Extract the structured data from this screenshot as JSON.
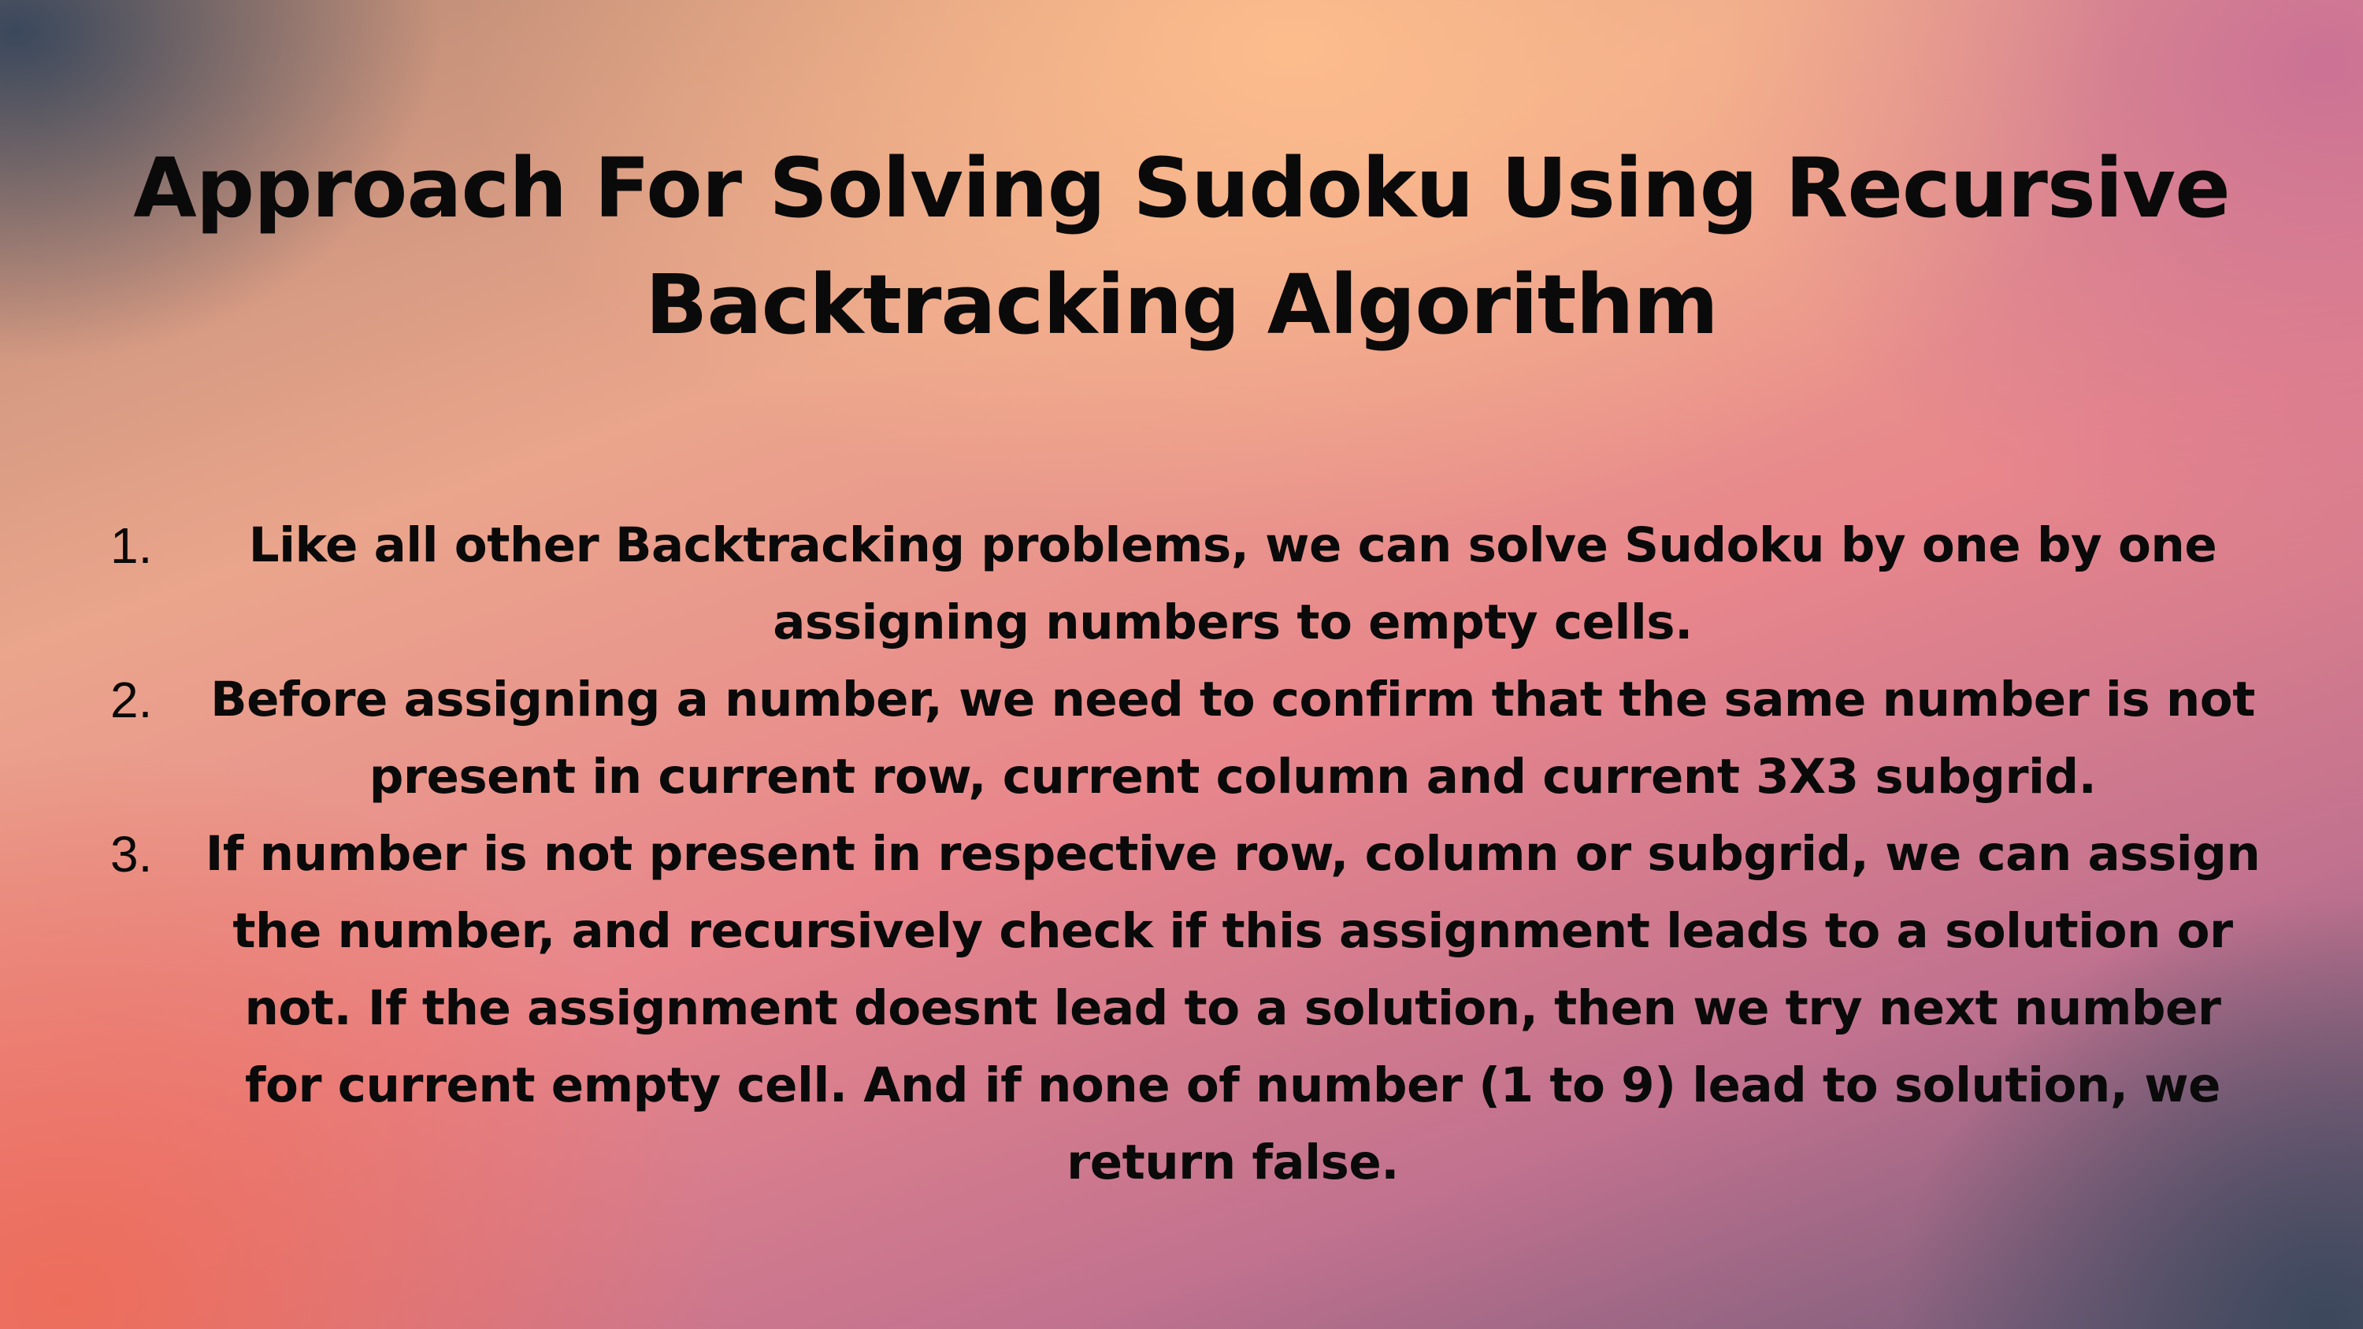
{
  "slide": {
    "title": "Approach For Solving Sudoku Using Recursive Backtracking Algorithm",
    "items": [
      {
        "number": "1.",
        "text": "Like all other Backtracking problems, we can solve Sudoku by one by one assigning numbers to empty cells."
      },
      {
        "number": "2.",
        "text": "Before assigning a number, we need to confirm that the same number is not present in current row, current column and current 3X3 subgrid."
      },
      {
        "number": "3.",
        "text": "If number is not present in respective row, column or subgrid, we can assign the number, and recursively check if this assignment leads to a solution or not. If the assignment doesnt lead to a solution, then we try next number for current empty cell. And if none of number (1 to 9) lead to solution, we return false."
      }
    ]
  },
  "colors": {
    "text": "#0a0a0a",
    "gradient_peach": "#ffbe8c",
    "gradient_coral": "#ee6c58",
    "gradient_pink": "#e8868c",
    "gradient_mauve": "#c2728f",
    "gradient_slate": "#3c485c"
  }
}
